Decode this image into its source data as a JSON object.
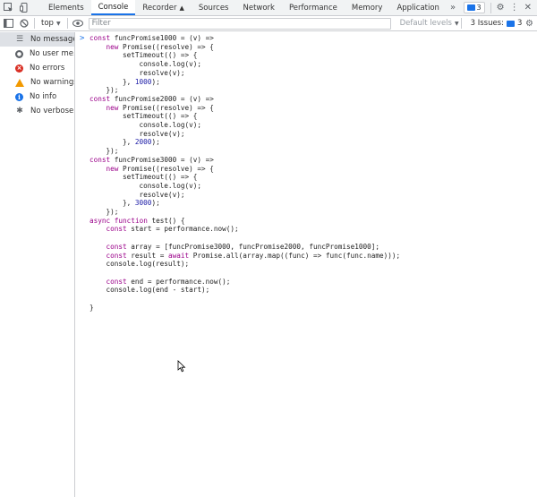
{
  "tabs": [
    {
      "label": "Elements"
    },
    {
      "label": "Console"
    },
    {
      "label": "Recorder"
    },
    {
      "label": "Sources"
    },
    {
      "label": "Network"
    },
    {
      "label": "Performance"
    },
    {
      "label": "Memory"
    },
    {
      "label": "Application"
    }
  ],
  "topbar": {
    "issues_count": "3"
  },
  "toolbar": {
    "context": "top",
    "filter_placeholder": "Filter",
    "levels": "Default levels",
    "issues_label": "3 Issues:",
    "issues_count": "3"
  },
  "sidebar": {
    "items": [
      {
        "label": "No messages"
      },
      {
        "label": "No user me..."
      },
      {
        "label": "No errors"
      },
      {
        "label": "No warnings"
      },
      {
        "label": "No info"
      },
      {
        "label": "No verbose"
      }
    ]
  },
  "console": {
    "prompt": ">",
    "code_lines": [
      "const funcPromise1000 = (v) =>",
      "    new Promise((resolve) => {",
      "        setTimeout(() => {",
      "            console.log(v);",
      "            resolve(v);",
      "        }, 1000);",
      "    });",
      "const funcPromise2000 = (v) =>",
      "    new Promise((resolve) => {",
      "        setTimeout(() => {",
      "            console.log(v);",
      "            resolve(v);",
      "        }, 2000);",
      "    });",
      "const funcPromise3000 = (v) =>",
      "    new Promise((resolve) => {",
      "        setTimeout(() => {",
      "            console.log(v);",
      "            resolve(v);",
      "        }, 3000);",
      "    });",
      "async function test() {",
      "    const start = performance.now();",
      "",
      "    const array = [funcPromise3000, funcPromise2000, funcPromise1000];",
      "    const result = await Promise.all(array.map((func) => func(func.name)));",
      "    console.log(result);",
      "",
      "    const end = performance.now();",
      "    console.log(end - start);",
      "",
      "}"
    ]
  }
}
